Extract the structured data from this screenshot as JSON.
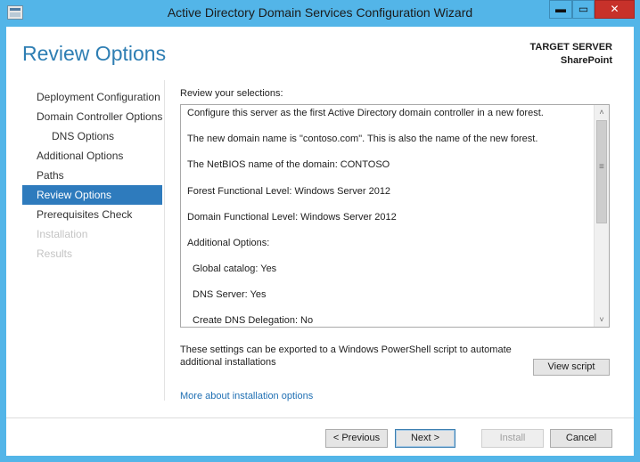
{
  "window": {
    "title": "Active Directory Domain Services Configuration Wizard",
    "controls": {
      "minimize": "▬",
      "maximize": "▭",
      "close": "✕"
    }
  },
  "header": {
    "page_title": "Review Options",
    "target_label": "TARGET SERVER",
    "target_name": "SharePoint"
  },
  "nav": {
    "items": [
      {
        "label": "Deployment Configuration",
        "state": "normal"
      },
      {
        "label": "Domain Controller Options",
        "state": "normal"
      },
      {
        "label": "DNS Options",
        "state": "normal"
      },
      {
        "label": "Additional Options",
        "state": "normal"
      },
      {
        "label": "Paths",
        "state": "normal"
      },
      {
        "label": "Review Options",
        "state": "active"
      },
      {
        "label": "Prerequisites Check",
        "state": "normal"
      },
      {
        "label": "Installation",
        "state": "disabled"
      },
      {
        "label": "Results",
        "state": "disabled"
      }
    ]
  },
  "review": {
    "label": "Review your selections:",
    "lines": [
      "Configure this server as the first Active Directory domain controller in a new forest.",
      "The new domain name is \"contoso.com\". This is also the name of the new forest.",
      "The NetBIOS name of the domain: CONTOSO",
      "Forest Functional Level: Windows Server 2012",
      "Domain Functional Level: Windows Server 2012",
      "Additional Options:",
      "Global catalog: Yes",
      "DNS Server: Yes",
      "Create DNS Delegation: No"
    ],
    "scroll_up": "˄",
    "scroll_down": "˅",
    "scroll_grip": "≡"
  },
  "export": {
    "text": "These settings can be exported to a Windows PowerShell script to automate additional installations",
    "view_script_label": "View script"
  },
  "more_link": "More about installation options",
  "footer": {
    "previous_label": "< Previous",
    "next_label": "Next >",
    "install_label": "Install",
    "cancel_label": "Cancel"
  },
  "colors": {
    "frame": "#53b5e8",
    "accent": "#2e7bbd",
    "title_text": "#2e7eb3",
    "link": "#1f6fb3",
    "close_button": "#c7312a"
  }
}
